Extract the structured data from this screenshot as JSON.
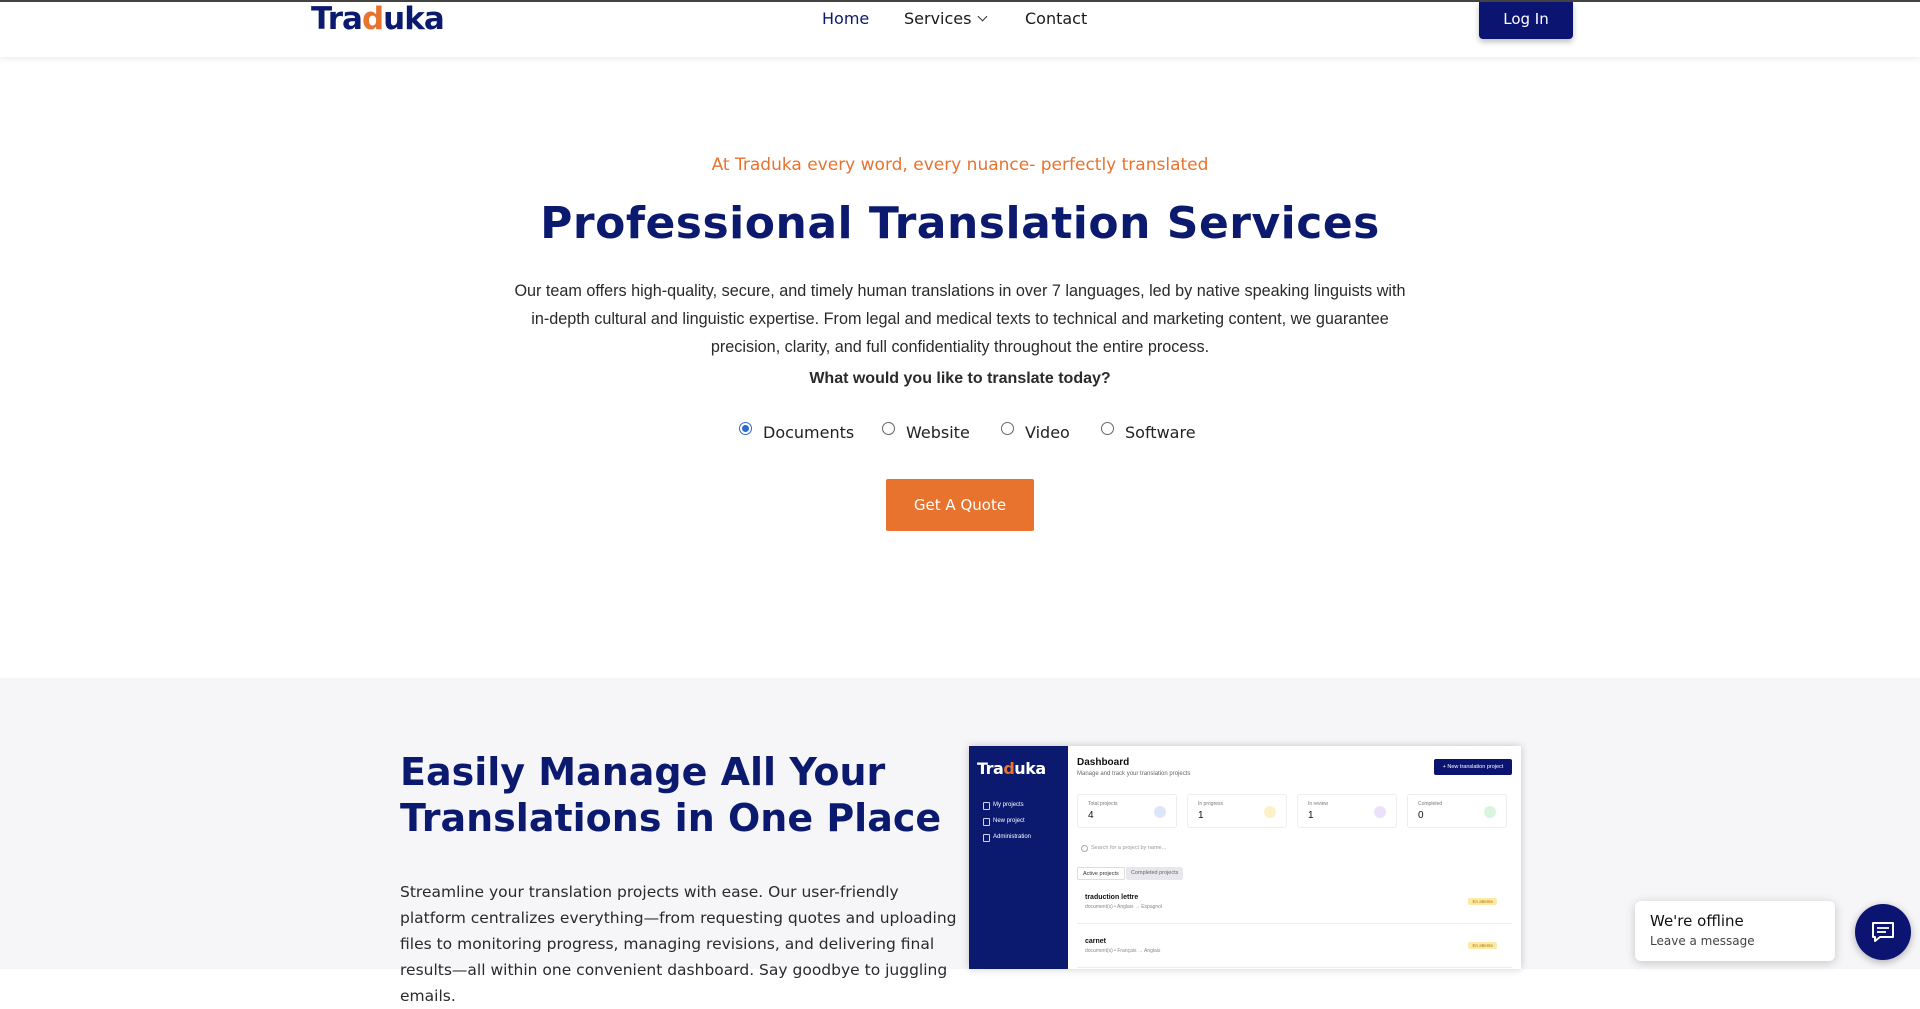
{
  "header": {
    "logo": {
      "part1": "Tra",
      "accent": "d",
      "part2": "uka"
    },
    "nav": [
      {
        "label": "Home",
        "active": true
      },
      {
        "label": "Services",
        "has_dropdown": true
      },
      {
        "label": "Contact"
      }
    ],
    "login_label": "Log In"
  },
  "hero": {
    "tagline": "At Traduka every word, every nuance- perfectly translated",
    "title": "Professional Translation Services",
    "description": "Our team offers high-quality, secure, and timely human translations in over 7 languages, led by native speaking linguists with in-depth cultural and linguistic expertise. From legal and medical texts to technical and marketing content, we guarantee precision, clarity, and full confidentiality throughout the entire process.",
    "question": "What would you like to translate today?",
    "options": [
      {
        "label": "Documents",
        "selected": true
      },
      {
        "label": "Website",
        "selected": false
      },
      {
        "label": "Video",
        "selected": false
      },
      {
        "label": "Software",
        "selected": false
      }
    ],
    "cta_label": "Get A Quote"
  },
  "manage": {
    "title": "Easily Manage All Your Translations in One Place",
    "description": "Streamline your translation projects with ease. Our user-friendly platform centralizes everything—from requesting quotes and uploading files to monitoring progress, managing revisions, and delivering final results—all within one convenient dashboard. Say goodbye to juggling emails."
  },
  "dashboard_preview": {
    "logo": {
      "part1": "Tra",
      "accent": "d",
      "part2": "uka"
    },
    "nav": [
      "My projects",
      "New project",
      "Administration"
    ],
    "title": "Dashboard",
    "subtitle": "Manage and track your translation projects",
    "new_button": "+ New translation project",
    "stats": [
      {
        "label": "Total projects",
        "value": "4",
        "color": "#dfe6fb"
      },
      {
        "label": "In progress",
        "value": "1",
        "color": "#fdf1c7"
      },
      {
        "label": "In review",
        "value": "1",
        "color": "#ece1fb"
      },
      {
        "label": "Completed",
        "value": "0",
        "color": "#d9f5df"
      }
    ],
    "search_placeholder": "Search for a project by name...",
    "tabs": [
      "Active projects",
      "Completed projects"
    ],
    "rows": [
      {
        "name": "traduction lettre",
        "sub": "document(s) • Anglais → Espagnol",
        "badge": "En attente"
      },
      {
        "name": "carnet",
        "sub": "document(s) • Français → Anglais",
        "badge": "En attente"
      }
    ]
  },
  "chat": {
    "title": "We're offline",
    "subtitle": "Leave a message"
  },
  "colors": {
    "brand_navy": "#0b1a6e",
    "accent_orange": "#e8732e"
  }
}
